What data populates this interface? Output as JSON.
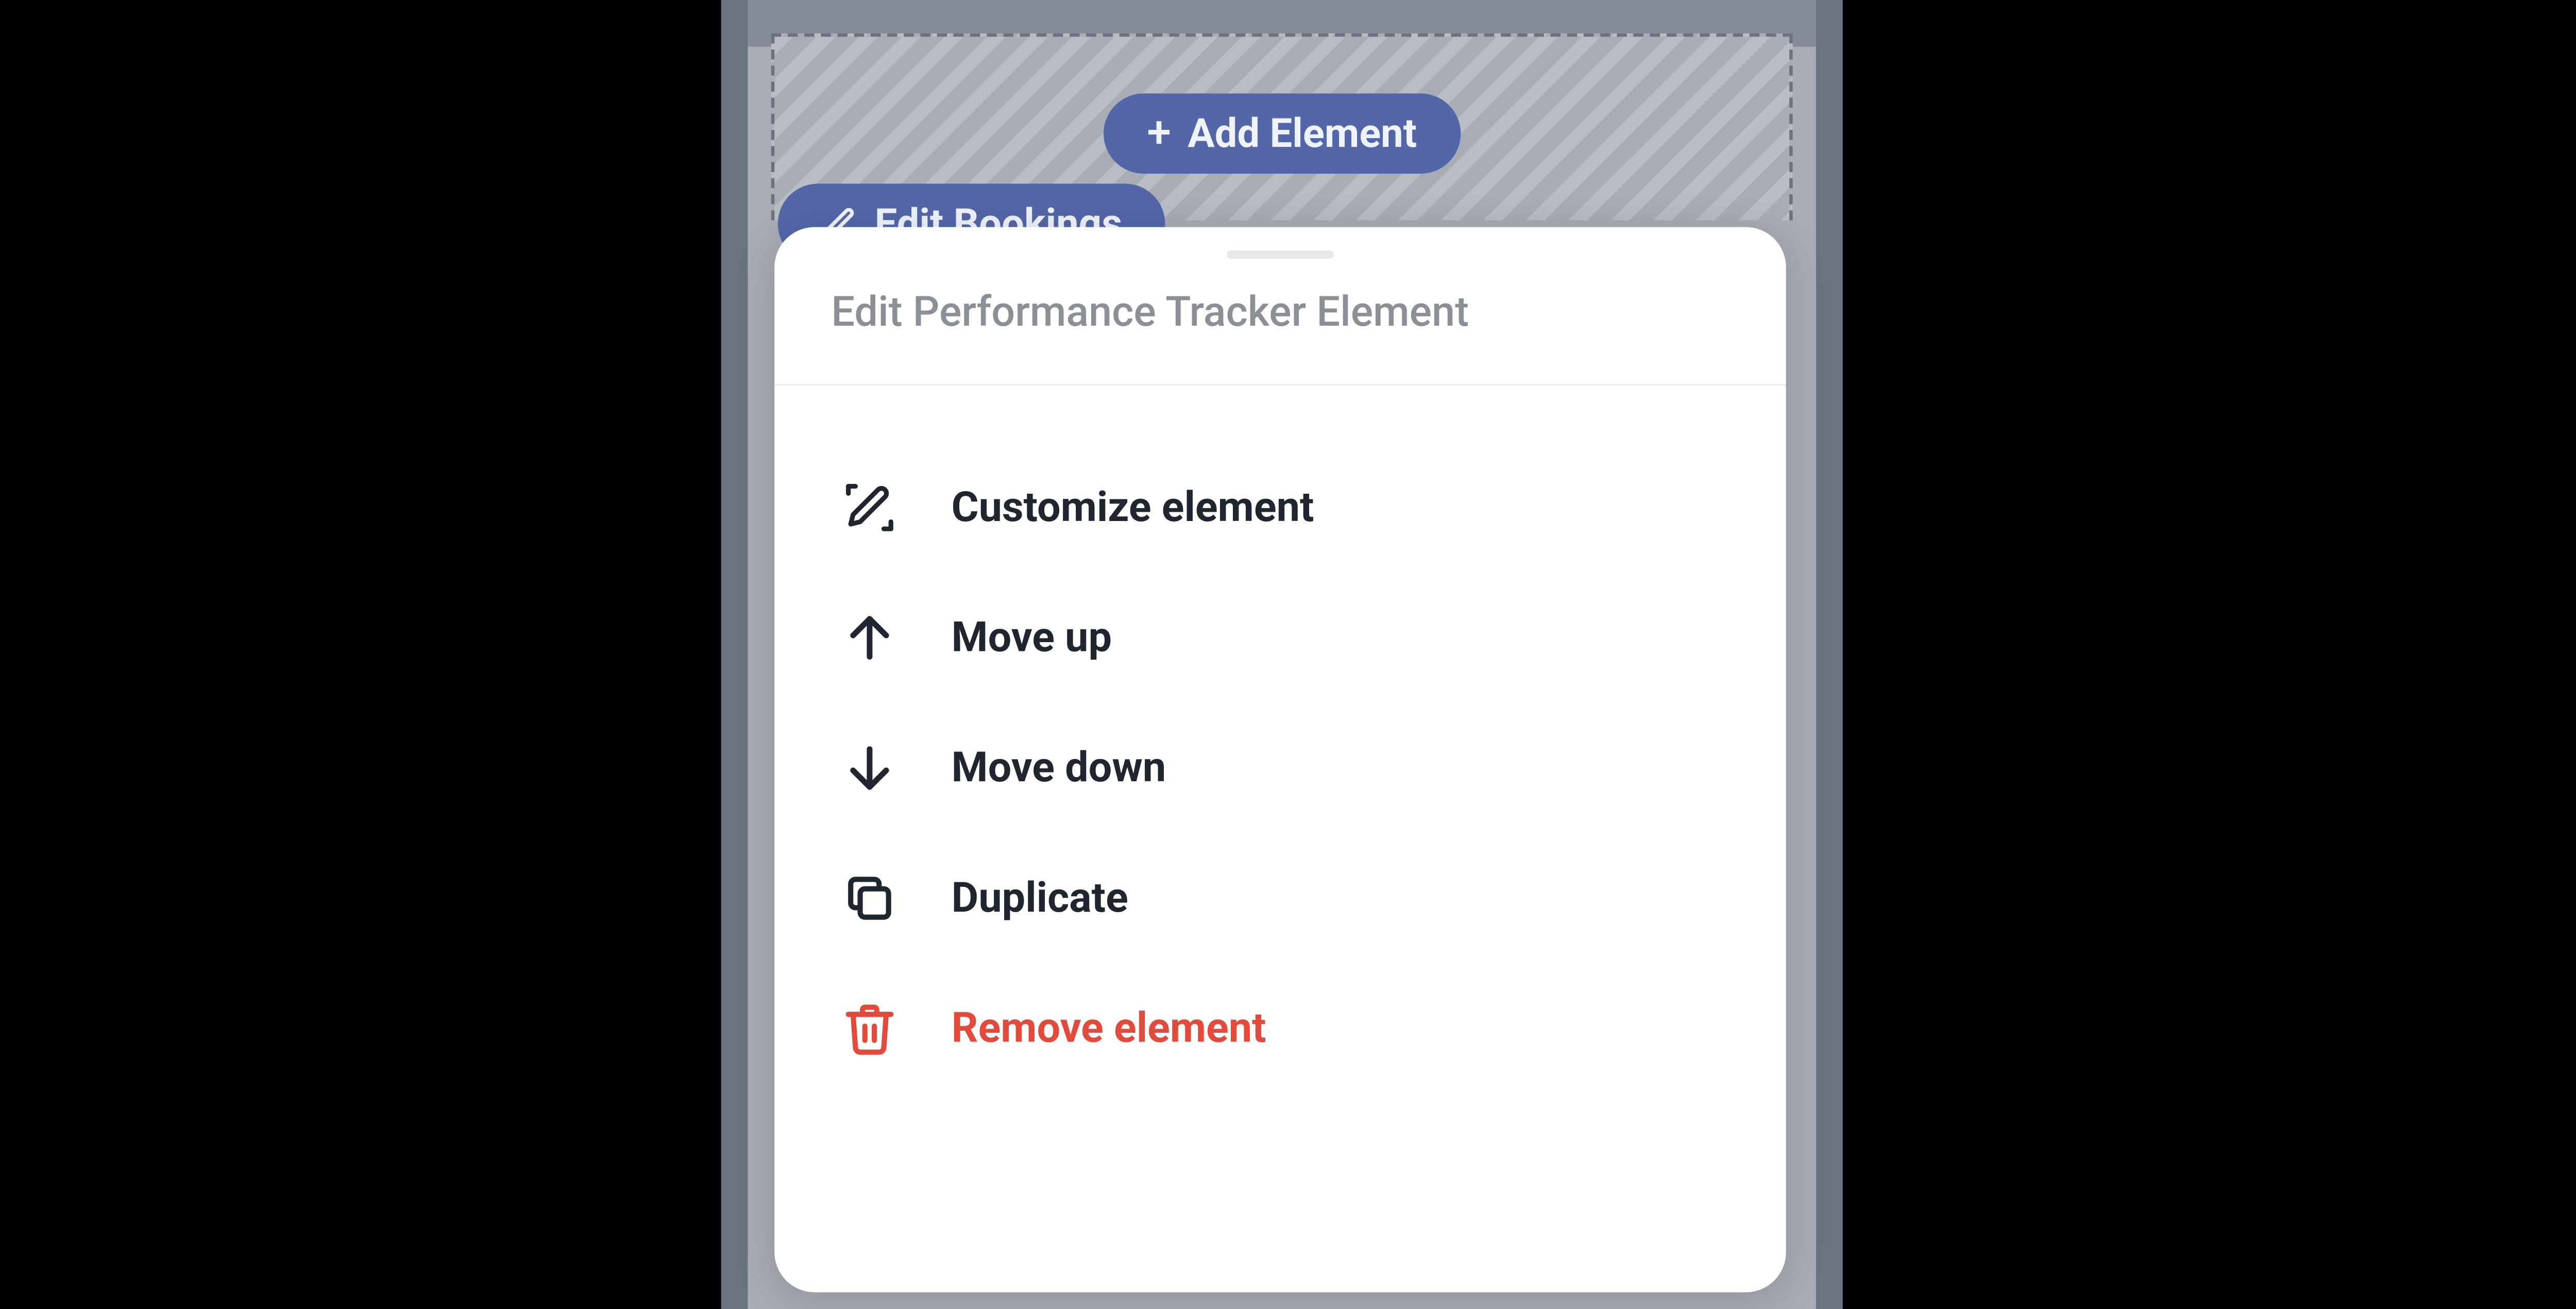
{
  "toolbar": {
    "add_label": "Add Element",
    "edit_label": "Edit Bookings"
  },
  "sheet": {
    "title": "Edit Performance Tracker Element",
    "items": [
      {
        "label": "Customize element"
      },
      {
        "label": "Move up"
      },
      {
        "label": "Move down"
      },
      {
        "label": "Duplicate"
      },
      {
        "label": "Remove element"
      }
    ]
  }
}
